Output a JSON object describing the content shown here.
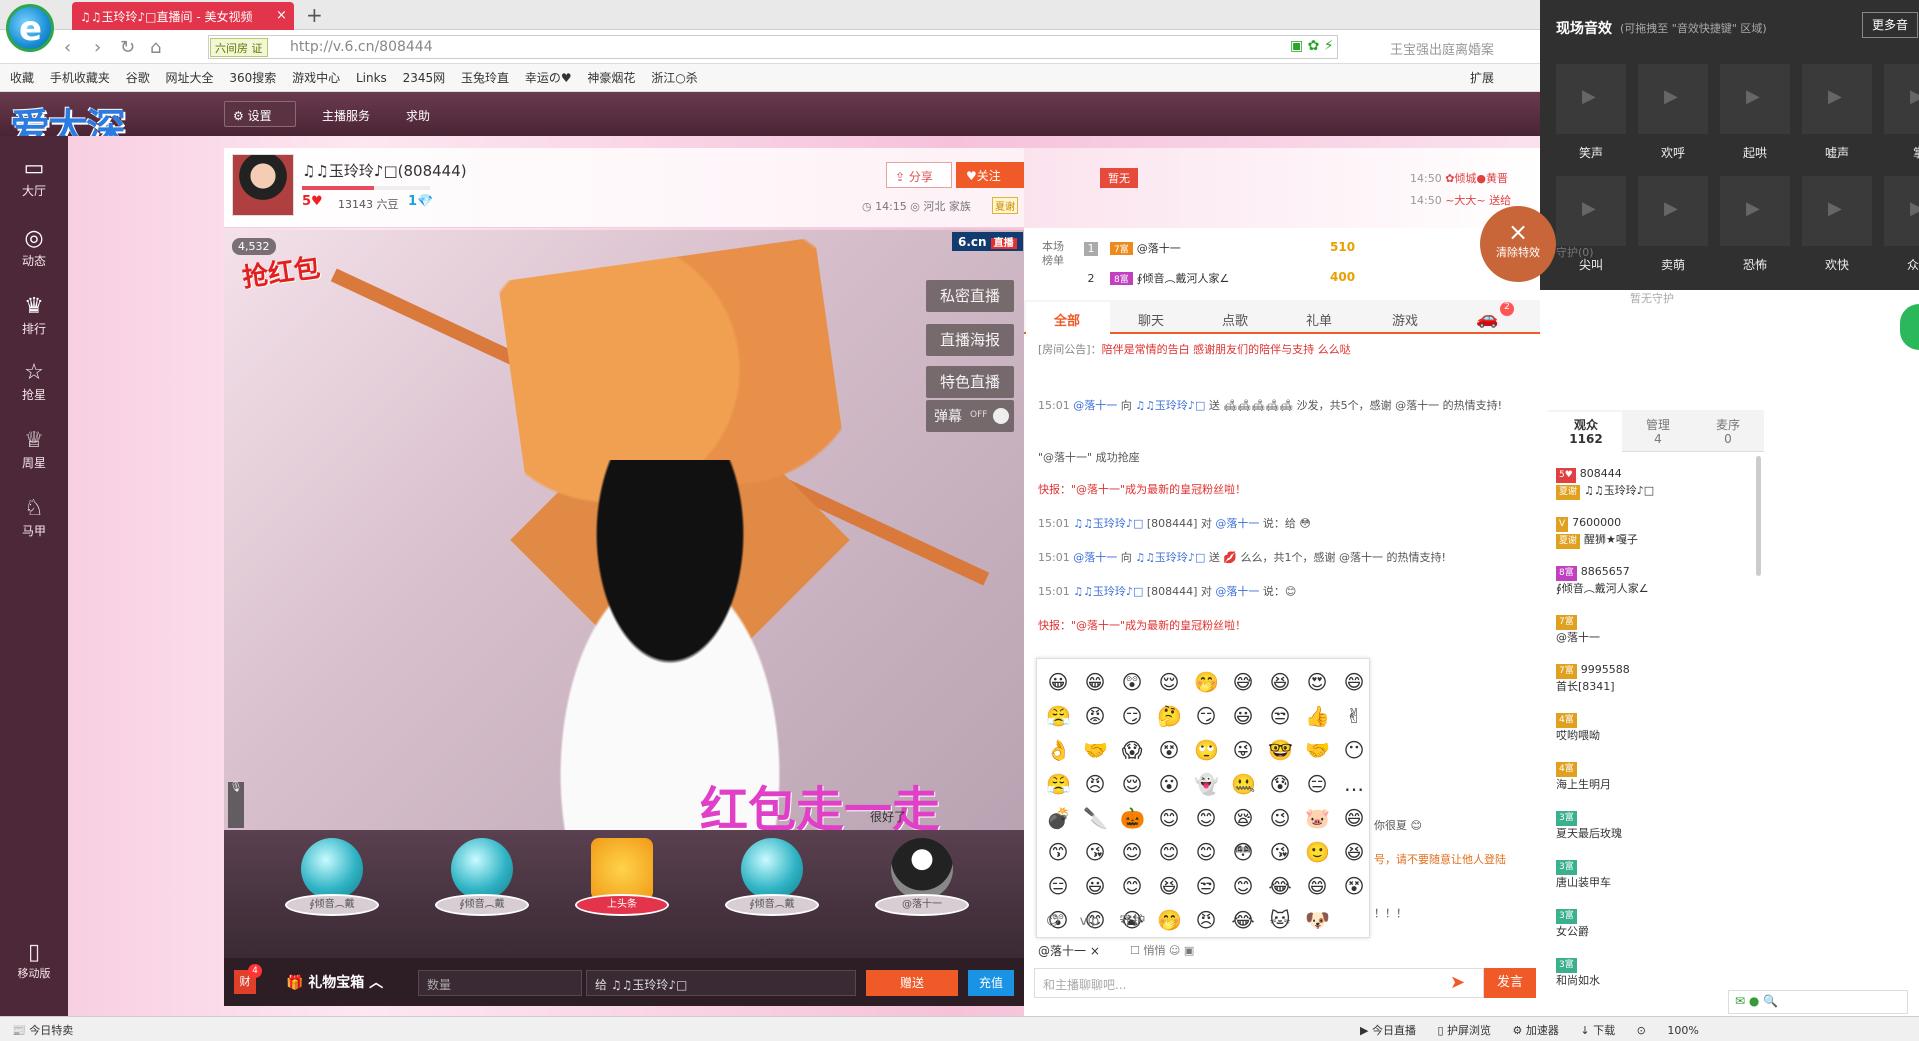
{
  "browser": {
    "tab_title": "♫♫玉玲玲♪□直播间 - 美女视频",
    "tab_close": "×",
    "new_tab": "+",
    "logo_glyph": "e",
    "addr_tag": "六间房 证",
    "url": "http://v.6.cn/808444",
    "search_placeholder": "王宝强出庭离婚案",
    "bookmarks": [
      "收藏",
      "手机收藏夹",
      "谷歌",
      "网址大全",
      "360搜索",
      "游戏中心",
      "Links",
      "2345网",
      "玉兔玲直",
      "幸运の♥",
      "神豪烟花",
      "浙江○杀"
    ],
    "bookmarks_more": "扩展"
  },
  "site": {
    "logo_text": "爱太深",
    "settings": "设置",
    "anchor_service": "主播服务",
    "help": "求助"
  },
  "left_nav": {
    "items": [
      {
        "icon": "▭",
        "label": "大厅"
      },
      {
        "icon": "◎",
        "label": "动态"
      },
      {
        "icon": "♛",
        "label": "排行"
      },
      {
        "icon": "☆",
        "label": "抢星"
      },
      {
        "icon": "♕",
        "label": "周星"
      },
      {
        "icon": "♘",
        "label": "马甲"
      }
    ],
    "mobile": "移动版"
  },
  "anchor": {
    "name": "♫♫玉玲玲♪□(808444)",
    "level": "5♥",
    "beans": "13143 六豆",
    "level2": "1💎",
    "progress_pct": 56,
    "share": "分享",
    "follow": "♥关注",
    "meta": "◷ 14:15   ◎ 河北   家族",
    "family": "夏谢"
  },
  "video": {
    "viewers": "4,532",
    "sticker": "抢红包",
    "brand": "6.cn",
    "brand_tag": "直播",
    "buttons": [
      "私密直播",
      "直播海报",
      "特色直播"
    ],
    "danmu": "弹幕",
    "danmu_state": "OFF",
    "banner": "红包走一走",
    "caption": "很好了"
  },
  "seats": [
    {
      "label": "∮倾音︵戴",
      "kind": "orb"
    },
    {
      "label": "∮倾音︵戴",
      "kind": "orb"
    },
    {
      "label": "上头条",
      "kind": "gold"
    },
    {
      "label": "∮倾音︵戴",
      "kind": "orb"
    },
    {
      "label": "@落十一",
      "kind": "avatar"
    }
  ],
  "gift_bar": {
    "fortune": "财",
    "fortune_count": "4",
    "gift_box": "🎁 礼物宝箱 ︿",
    "qty_placeholder": "数量",
    "recipient": "给 ♫♫玉玲玲♪□",
    "send": "赠送",
    "recharge": "充值"
  },
  "chat": {
    "dou_flag": "暂无",
    "notes": [
      {
        "time": "14:50",
        "text": "✿倾城●黄晋"
      },
      {
        "time": "14:50",
        "text": "~大大~ 送给"
      }
    ],
    "rank_label": "本场榜单",
    "rank": [
      {
        "num": "1",
        "badge": "7富",
        "name": "@落十一",
        "value": "510"
      },
      {
        "num": "2",
        "badge": "8富",
        "name": "∮倾音︵戴河人家∠",
        "value": "400"
      }
    ],
    "tabs": [
      "全部",
      "聊天",
      "点歌",
      "礼单",
      "游戏"
    ],
    "car_badge": "2",
    "announcement_label": "[房间公告]：",
    "announcement": "陪伴是常情的告白 感谢朋友们的陪伴与支持 么么哒",
    "lines": [
      {
        "time": "15:01",
        "user": "@落十一",
        "mid": " 向 ",
        "user2": "♫♫玉玲玲♪□",
        "text": " 送 🛋🛋🛋🛋🛋 沙发，共5个，感谢 @落十一 的热情支持!"
      },
      {
        "time": "",
        "user": "",
        "mid": "",
        "user2": "",
        "text": "\"@落十一\" 成功抢座"
      },
      {
        "time": "",
        "user": "",
        "mid": "",
        "user2": "",
        "text": "快报：\"@落十一\"成为最新的皇冠粉丝啦！"
      },
      {
        "time": "15:01",
        "user": "♫♫玉玲玲♪□",
        "mid": " [808444] 对 ",
        "user2": "@落十一",
        "text": " 说：给 😳"
      },
      {
        "time": "15:01",
        "user": "@落十一",
        "mid": " 向 ",
        "user2": "♫♫玉玲玲♪□",
        "text": " 送 💋 么么，共1个，感谢 @落十一 的热情支持!"
      },
      {
        "time": "15:01",
        "user": "♫♫玉玲玲♪□",
        "mid": " [808444] 对 ",
        "user2": "@落十一",
        "text": " 说：😊"
      },
      {
        "time": "",
        "user": "",
        "mid": "",
        "user2": "",
        "text": "快报：\"@落十一\"成为最新的皇冠粉丝啦！"
      }
    ],
    "partial_right_1": "你很夏 😊",
    "partial_right_2": "号，请不要随意让他人登陆",
    "partial_right_3": "！！！",
    "emoji": [
      "😀",
      "😁",
      "😲",
      "😌",
      "🤭",
      "😅",
      "😆",
      "😍",
      "😄",
      "😤",
      "😡",
      "😏",
      "🤔",
      "😏",
      "😃",
      "😒",
      "👍",
      "✌",
      "👌",
      "🤝",
      "😱",
      "😵",
      "🙄",
      "😜",
      "🤓",
      "🤝",
      "😶",
      "😤",
      "😠",
      "😌",
      "😮",
      "👻",
      "🤐",
      "😰",
      "😑",
      "…",
      "💣",
      "🔪",
      "🎃",
      "😊",
      "😊",
      "😪",
      "😉",
      "🐷",
      "😄",
      "😙",
      "😘",
      "😊",
      "😊",
      "😊",
      "😳",
      "😘",
      "🙂",
      "😆",
      "😑",
      "😃",
      "😊",
      "😆",
      "😒",
      "😊",
      "😂",
      "😄",
      "😵",
      "😲",
      "😊",
      "😭",
      "🤭",
      "😠",
      "😂",
      "🐱",
      "🐶"
    ],
    "emoji_tabs": [
      "☺",
      "vip",
      "守护"
    ],
    "target": "@落十一",
    "target_close": "×",
    "options": "☐ 悄悄   ☺   ▣",
    "input_placeholder": "和主播聊聊吧...",
    "send": "发言"
  },
  "guard": {
    "empty": "暂无守护",
    "label": "守护(0)"
  },
  "audience": {
    "tabs": [
      {
        "label": "观众",
        "count": "1162"
      },
      {
        "label": "管理",
        "count": "4"
      },
      {
        "label": "麦序",
        "count": "0"
      }
    ],
    "members": [
      {
        "badge": "5♥",
        "badge_kind": "r",
        "id": "808444",
        "sub_badge": "夏谢",
        "name": "♫♫玉玲玲♪□"
      },
      {
        "badge": "V",
        "badge_kind": "o",
        "id": "7600000",
        "sub_badge": "夏谢",
        "name": "醒狮★嘎子"
      },
      {
        "badge": "8富",
        "badge_kind": "p",
        "id": "8865657",
        "sub_badge": "",
        "name": "∮倾音︵戴河人家∠"
      },
      {
        "badge": "7富",
        "badge_kind": "o",
        "id": "",
        "sub_badge": "",
        "name": "@落十一"
      },
      {
        "badge": "7富",
        "badge_kind": "o",
        "id": "9995588",
        "sub_badge": "",
        "name": "首长[8341]"
      },
      {
        "badge": "4富",
        "badge_kind": "o",
        "id": "",
        "sub_badge": "",
        "name": "哎哟喂呦"
      },
      {
        "badge": "4富",
        "badge_kind": "o",
        "id": "",
        "sub_badge": "",
        "name": "海上生明月"
      },
      {
        "badge": "3富",
        "badge_kind": "",
        "id": "",
        "sub_badge": "",
        "name": "夏天最后玫瑰"
      },
      {
        "badge": "3富",
        "badge_kind": "",
        "id": "",
        "sub_badge": "",
        "name": "唐山装甲车"
      },
      {
        "badge": "3富",
        "badge_kind": "",
        "id": "",
        "sub_badge": "",
        "name": "女公爵"
      },
      {
        "badge": "3富",
        "badge_kind": "",
        "id": "",
        "sub_badge": "",
        "name": "和尚如水"
      }
    ]
  },
  "effects": {
    "title": "现场音效",
    "hint": "(可拖拽至 \"音效快捷键\" 区域)",
    "more": "更多音",
    "row1": [
      "笑声",
      "欢呼",
      "起哄",
      "嘘声",
      "掌"
    ],
    "row2": [
      "尖叫",
      "卖萌",
      "恐怖",
      "欢快",
      "众人"
    ],
    "clear": "清除特效",
    "clear_icon": "×"
  },
  "status": {
    "left": "📰 今日特卖",
    "items": [
      "▶ 今日直播",
      "▯ 护屏浏览",
      "⚙ 加速器",
      "↓ 下载",
      "⊙",
      "100%"
    ],
    "mini": "✉ ● 🔍"
  }
}
